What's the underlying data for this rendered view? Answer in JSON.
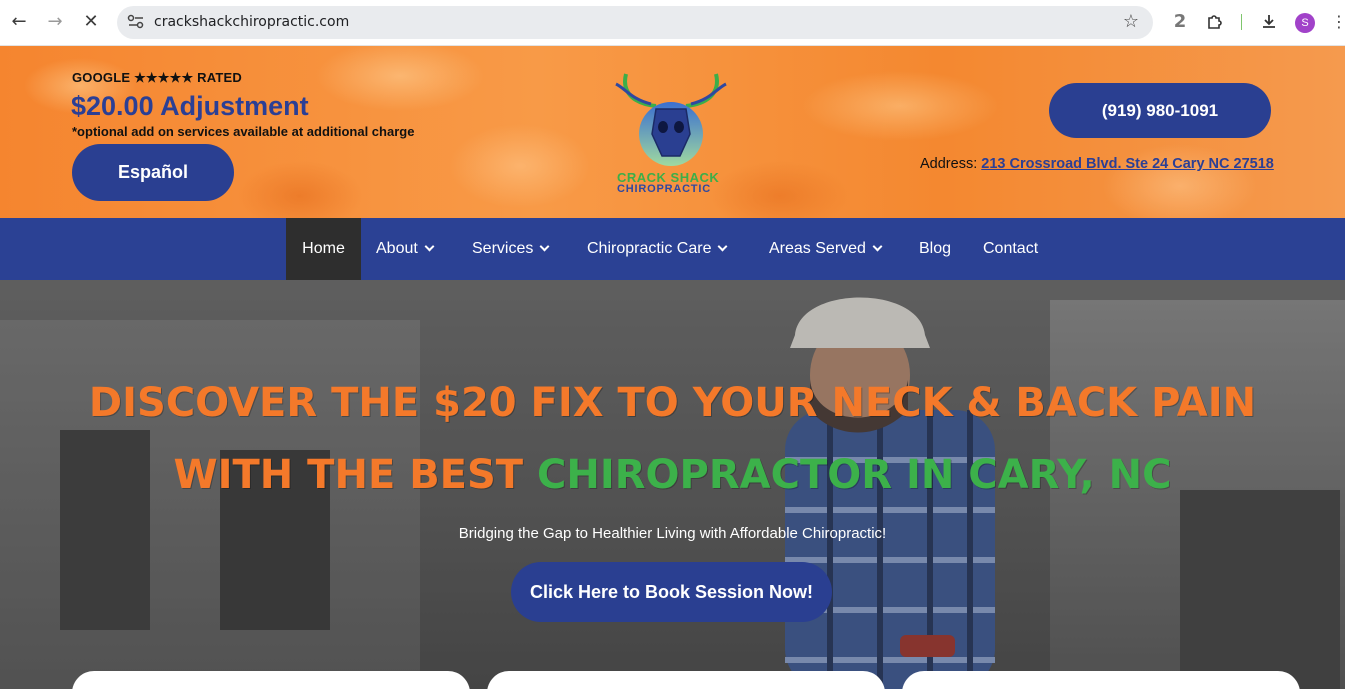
{
  "browser": {
    "url": "crackshackchiropractic.com",
    "profile_initial": "S",
    "extension_badge": "2"
  },
  "header": {
    "google_rated": "GOOGLE ★★★★★ RATED",
    "price": "$20.00 Adjustment",
    "note": "*optional add on services available at additional charge",
    "espanol_label": "Español",
    "logo_line1": "CRACK SHACK",
    "logo_line2": "CHIROPRACTIC",
    "phone": "(919) 980-1091",
    "address_label": "Address:",
    "address_link": "213 Crossroad Blvd. Ste 24 Cary NC 27518"
  },
  "nav": {
    "items": [
      {
        "label": "Home",
        "active": true
      },
      {
        "label": "About"
      },
      {
        "label": "Services"
      },
      {
        "label": "Chiropractic Care"
      },
      {
        "label": "Areas Served"
      },
      {
        "label": "Blog"
      },
      {
        "label": "Contact"
      }
    ]
  },
  "hero": {
    "headline1": "DISCOVER THE $20 FIX TO YOUR NECK & BACK PAIN",
    "headline2_part1": "WITH THE BEST ",
    "headline2_part2": "CHIROPRACTOR IN CARY, NC",
    "subline": "Bridging the Gap to Healthier Living with Affordable Chiropractic!",
    "cta": "Click Here to Book Session Now!"
  },
  "colors": {
    "brand_blue": "#2a3f91",
    "orange": "#f4792a",
    "green": "#3cb14a",
    "nav_active": "#2e2e2e"
  }
}
